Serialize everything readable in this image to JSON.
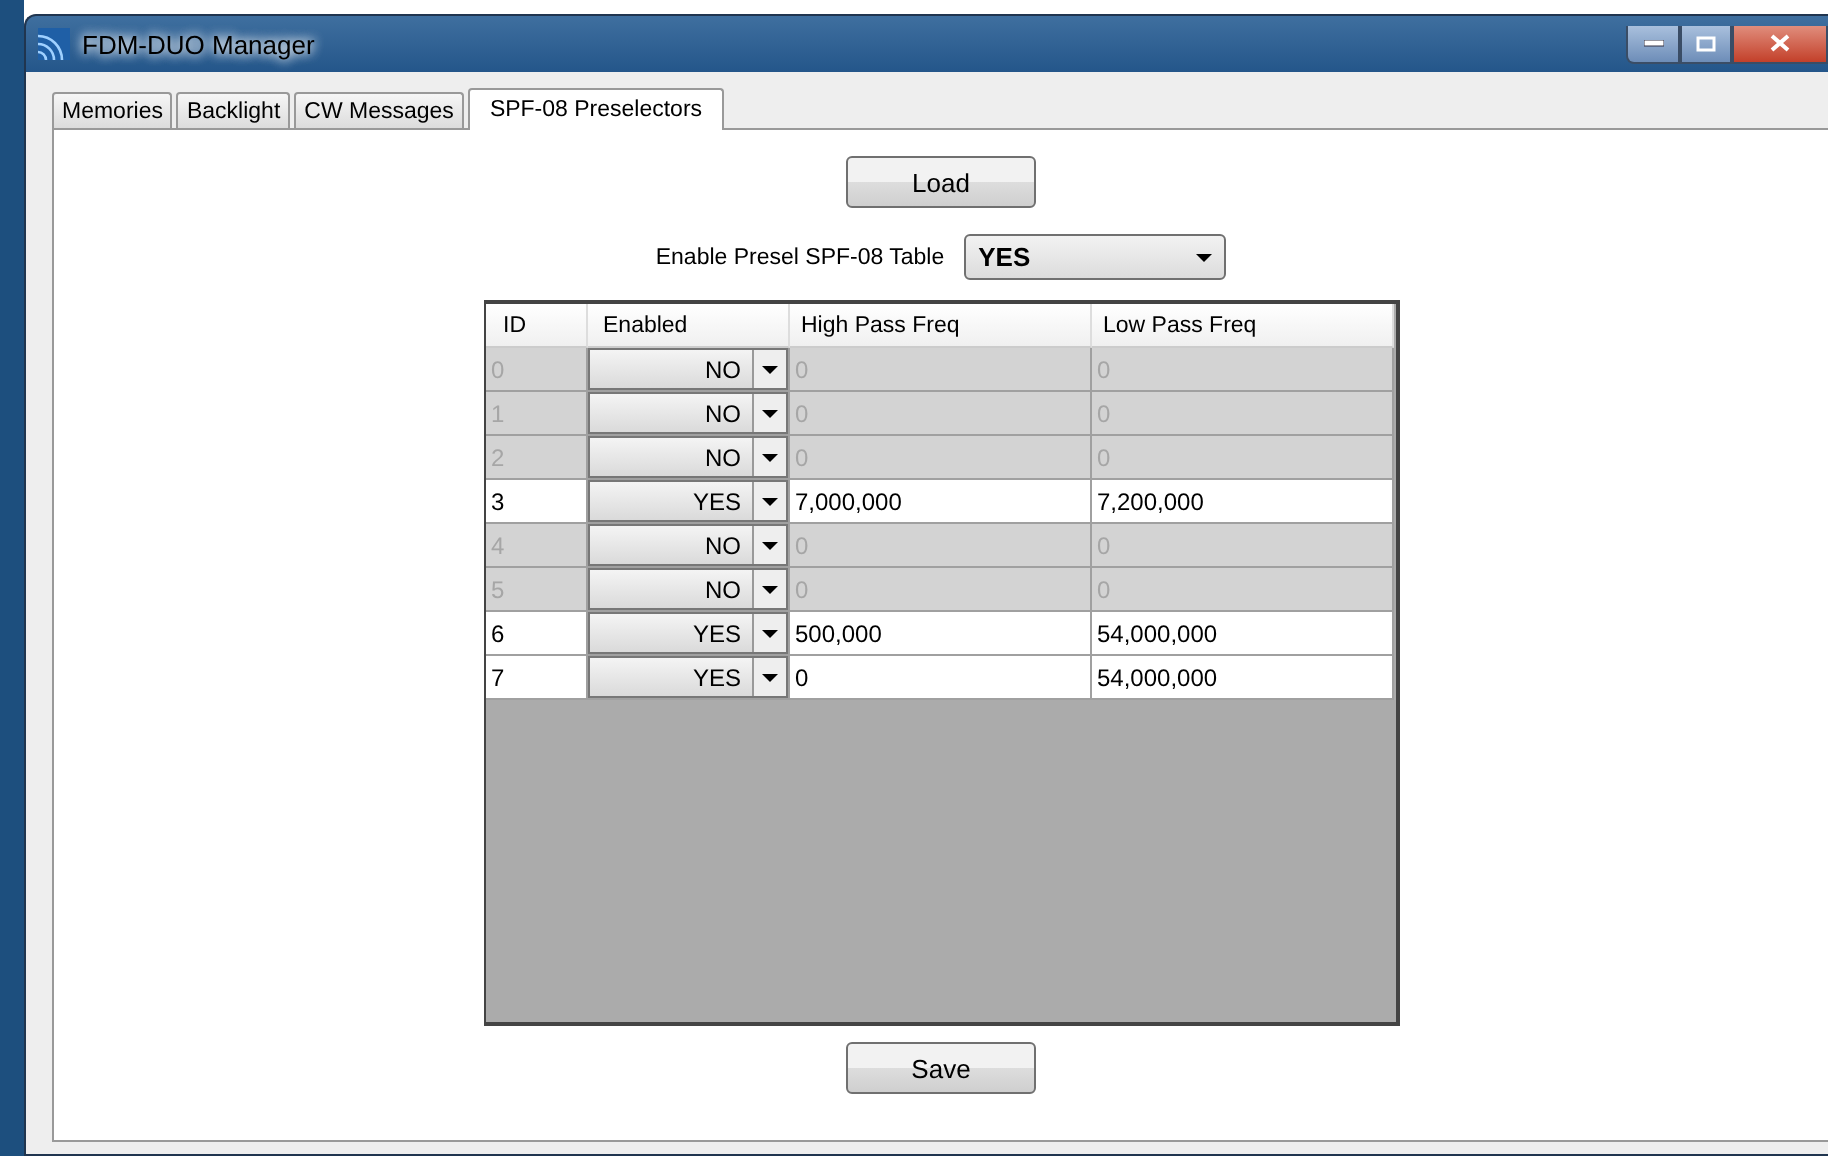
{
  "window": {
    "title": "FDM-DUO Manager"
  },
  "tabs": [
    {
      "label": "Memories",
      "selected": false
    },
    {
      "label": "Backlight",
      "selected": false
    },
    {
      "label": "CW Messages",
      "selected": false
    },
    {
      "label": "SPF-08 Preselectors",
      "selected": true
    }
  ],
  "load_button": "Load",
  "enable_table": {
    "label": "Enable Presel SPF-08 Table",
    "value": "YES"
  },
  "table": {
    "columns": [
      "ID",
      "Enabled",
      "High Pass Freq",
      "Low Pass Freq"
    ],
    "rows": [
      {
        "id": "0",
        "enabled_value": "NO",
        "high_pass": "0",
        "low_pass": "0",
        "active": false
      },
      {
        "id": "1",
        "enabled_value": "NO",
        "high_pass": "0",
        "low_pass": "0",
        "active": false
      },
      {
        "id": "2",
        "enabled_value": "NO",
        "high_pass": "0",
        "low_pass": "0",
        "active": false
      },
      {
        "id": "3",
        "enabled_value": "YES",
        "high_pass": "7,000,000",
        "low_pass": "7,200,000",
        "active": true
      },
      {
        "id": "4",
        "enabled_value": "NO",
        "high_pass": "0",
        "low_pass": "0",
        "active": false
      },
      {
        "id": "5",
        "enabled_value": "NO",
        "high_pass": "0",
        "low_pass": "0",
        "active": false
      },
      {
        "id": "6",
        "enabled_value": "YES",
        "high_pass": "500,000",
        "low_pass": "54,000,000",
        "active": true
      },
      {
        "id": "7",
        "enabled_value": "YES",
        "high_pass": "0",
        "low_pass": "54,000,000",
        "active": true
      }
    ]
  },
  "save_button": "Save"
}
